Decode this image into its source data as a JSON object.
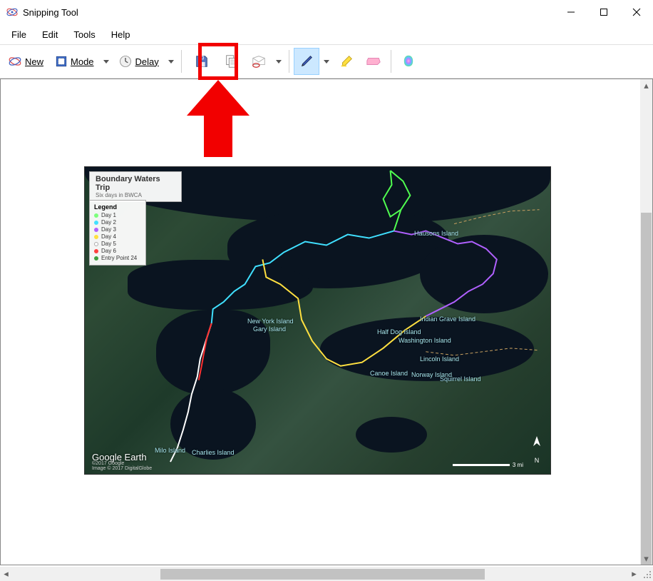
{
  "window": {
    "title": "Snipping Tool"
  },
  "menu": {
    "file": "File",
    "edit": "Edit",
    "tools": "Tools",
    "help": "Help"
  },
  "toolbar": {
    "new_label": "New",
    "mode_label": "Mode",
    "delay_label": "Delay"
  },
  "map": {
    "title": "Boundary Waters Trip",
    "subtitle": "Six days in BWCA",
    "legend": {
      "title": "Legend",
      "items": [
        {
          "label": "Day 1",
          "color": "#7cff7c"
        },
        {
          "label": "Day 2",
          "color": "#40e0ff"
        },
        {
          "label": "Day 3",
          "color": "#b060ff"
        },
        {
          "label": "Day 4",
          "color": "#ffe040"
        },
        {
          "label": "Day 5",
          "color": "#ffffff"
        },
        {
          "label": "Day 6",
          "color": "#ff4040"
        },
        {
          "label": "Entry Point 24",
          "color": "#40a040"
        }
      ]
    },
    "labels": {
      "hausons": "Hausons Island",
      "newyork": "New York Island",
      "gary": "Gary Island",
      "indian": "Indian Grave Island",
      "halfdog": "Half Dog Island",
      "washington": "Washington Island",
      "lincoln": "Lincoln Island",
      "canoe": "Canoe Island",
      "norway": "Norway Island",
      "squirrel": "Squirrel Island",
      "milo": "Milo Island",
      "charlies": "Charlies Island"
    },
    "branding": "Google Earth",
    "copyright1": "©2017 Google",
    "copyright2": "Image © 2017 DigitalGlobe",
    "north": "N",
    "scale": "3 mi"
  }
}
